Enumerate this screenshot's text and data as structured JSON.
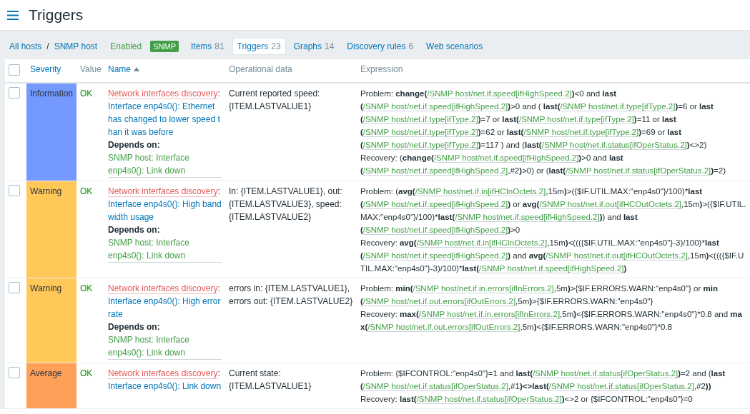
{
  "page": {
    "title": "Triggers"
  },
  "breadcrumb": [
    "All hosts",
    "SNMP host"
  ],
  "breadcrumb_separator": "/",
  "host_status": "Enabled",
  "availability_badges": [
    "SNMP"
  ],
  "tabs": [
    {
      "label": "Items",
      "count": "81",
      "selected": false
    },
    {
      "label": "Triggers",
      "count": "23",
      "selected": true
    },
    {
      "label": "Graphs",
      "count": "14",
      "selected": false
    },
    {
      "label": "Discovery rules",
      "count": "6",
      "selected": false
    },
    {
      "label": "Web scenarios",
      "selected": false
    }
  ],
  "table": {
    "select_all": {
      "checked": false
    },
    "name_separator": ":",
    "columns": [
      {
        "label": "Severity",
        "kind": "link",
        "sorted": false
      },
      {
        "label": "Value",
        "kind": "plain",
        "sorted": false
      },
      {
        "label": "Name",
        "kind": "link",
        "sorted": true
      },
      {
        "label": "Operational data",
        "kind": "plain",
        "sorted": false
      },
      {
        "label": "Expression",
        "kind": "plain",
        "sorted": false
      }
    ],
    "rows": [
      {
        "checked": false,
        "severity": "Information",
        "color": "#7499ff",
        "value": "OK",
        "name_prefix": "Network interfaces discovery",
        "name": "Interface enp4s0(): Ethernet has changed to lower speed than it was before",
        "depends_label": "Depends on:",
        "depends_on": [
          "SNMP host: Interface enp4s0(): Link down"
        ],
        "operational_data": "Current reported speed: {ITEM.LASTVALUE1}",
        "expression": [
          [
            {
              "kind": "text",
              "text": "Problem: "
            },
            {
              "kind": "func",
              "text": "change("
            },
            {
              "kind": "item",
              "text": "/SNMP host/net.if.speed[ifHighSpeed.2]"
            },
            {
              "kind": "func",
              "text": ")"
            },
            {
              "kind": "text",
              "text": "<0 and "
            },
            {
              "kind": "func",
              "text": "last("
            },
            {
              "kind": "item",
              "text": "/SNMP host/net.if.speed[ifHighSpeed.2]"
            },
            {
              "kind": "func",
              "text": ")"
            },
            {
              "kind": "text",
              "text": ">0 and ( "
            },
            {
              "kind": "func",
              "text": "last("
            },
            {
              "kind": "item",
              "text": "/SNMP host/net.if.type[ifType.2]"
            },
            {
              "kind": "func",
              "text": ")"
            },
            {
              "kind": "text",
              "text": "=6 or "
            },
            {
              "kind": "func",
              "text": "last("
            },
            {
              "kind": "item",
              "text": "/SNMP host/net.if.type[ifType.2]"
            },
            {
              "kind": "func",
              "text": ")"
            },
            {
              "kind": "text",
              "text": "=7 or "
            },
            {
              "kind": "func",
              "text": "last("
            },
            {
              "kind": "item",
              "text": "/SNMP host/net.if.type[ifType.2]"
            },
            {
              "kind": "func",
              "text": ")"
            },
            {
              "kind": "text",
              "text": "=11 or "
            },
            {
              "kind": "func",
              "text": "last("
            },
            {
              "kind": "item",
              "text": "/SNMP host/net.if.type[ifType.2]"
            },
            {
              "kind": "func",
              "text": ")"
            },
            {
              "kind": "text",
              "text": "=62 or "
            },
            {
              "kind": "func",
              "text": "last("
            },
            {
              "kind": "item",
              "text": "/SNMP host/net.if.type[ifType.2]"
            },
            {
              "kind": "func",
              "text": ")"
            },
            {
              "kind": "text",
              "text": "=69 or "
            },
            {
              "kind": "func",
              "text": "last("
            },
            {
              "kind": "item",
              "text": "/SNMP host/net.if.type[ifType.2]"
            },
            {
              "kind": "func",
              "text": ")"
            },
            {
              "kind": "text",
              "text": "=117 ) and ("
            },
            {
              "kind": "func",
              "text": "last("
            },
            {
              "kind": "item",
              "text": "/SNMP host/net.if.status[ifOperStatus.2]"
            },
            {
              "kind": "func",
              "text": ")"
            },
            {
              "kind": "text",
              "text": "<>2)"
            }
          ],
          [
            {
              "kind": "text",
              "text": "Recovery: ("
            },
            {
              "kind": "func",
              "text": "change("
            },
            {
              "kind": "item",
              "text": "/SNMP host/net.if.speed[ifHighSpeed.2]"
            },
            {
              "kind": "func",
              "text": ")"
            },
            {
              "kind": "text",
              "text": ">0 and "
            },
            {
              "kind": "func",
              "text": "last("
            },
            {
              "kind": "item",
              "text": "/SNMP host/net.if.speed[ifHighSpeed.2]"
            },
            {
              "kind": "text",
              "text": ",#2"
            },
            {
              "kind": "func",
              "text": ")"
            },
            {
              "kind": "text",
              "text": ">0) or ("
            },
            {
              "kind": "func",
              "text": "last("
            },
            {
              "kind": "item",
              "text": "/SNMP host/net.if.status[ifOperStatus.2]"
            },
            {
              "kind": "func",
              "text": ")"
            },
            {
              "kind": "text",
              "text": "=2)"
            }
          ]
        ]
      },
      {
        "checked": false,
        "severity": "Warning",
        "color": "#ffc859",
        "value": "OK",
        "name_prefix": "Network interfaces discovery",
        "name": "Interface enp4s0(): High bandwidth usage",
        "depends_label": "Depends on:",
        "depends_on": [
          "SNMP host: Interface enp4s0(): Link down"
        ],
        "operational_data": "In: {ITEM.LASTVALUE1}, out: {ITEM.LASTVALUE3}, speed: {ITEM.LASTVALUE2}",
        "expression": [
          [
            {
              "kind": "text",
              "text": "Problem: ("
            },
            {
              "kind": "func",
              "text": "avg("
            },
            {
              "kind": "item",
              "text": "/SNMP host/net.if.in[ifHCInOctets.2]"
            },
            {
              "kind": "text",
              "text": ",15m"
            },
            {
              "kind": "func",
              "text": ")"
            },
            {
              "kind": "text",
              "text": ">({$IF.UTIL.MAX:\"enp4s0\"}/100)*"
            },
            {
              "kind": "func",
              "text": "last("
            },
            {
              "kind": "item",
              "text": "/SNMP host/net.if.speed[ifHighSpeed.2]"
            },
            {
              "kind": "func",
              "text": ")"
            },
            {
              "kind": "text",
              "text": " or "
            },
            {
              "kind": "func",
              "text": "avg("
            },
            {
              "kind": "item",
              "text": "/SNMP host/net.if.out[ifHCOutOctets.2]"
            },
            {
              "kind": "text",
              "text": ",15m"
            },
            {
              "kind": "func",
              "text": ")"
            },
            {
              "kind": "text",
              "text": ">({$IF.UTIL.MAX:\"enp4s0\"}/100)*"
            },
            {
              "kind": "func",
              "text": "last("
            },
            {
              "kind": "item",
              "text": "/SNMP host/net.if.speed[ifHighSpeed.2]"
            },
            {
              "kind": "func",
              "text": ")"
            },
            {
              "kind": "text",
              "text": ") and "
            },
            {
              "kind": "func",
              "text": "last("
            },
            {
              "kind": "item",
              "text": "/SNMP host/net.if.speed[ifHighSpeed.2]"
            },
            {
              "kind": "func",
              "text": ")"
            },
            {
              "kind": "text",
              "text": ">0"
            }
          ],
          [
            {
              "kind": "text",
              "text": "Recovery: "
            },
            {
              "kind": "func",
              "text": "avg("
            },
            {
              "kind": "item",
              "text": "/SNMP host/net.if.in[ifHCInOctets.2]"
            },
            {
              "kind": "text",
              "text": ",15m"
            },
            {
              "kind": "func",
              "text": ")"
            },
            {
              "kind": "text",
              "text": "<((({$IF.UTIL.MAX:\"enp4s0\"}-3)/100)*"
            },
            {
              "kind": "func",
              "text": "last("
            },
            {
              "kind": "item",
              "text": "/SNMP host/net.if.speed[ifHighSpeed.2]"
            },
            {
              "kind": "func",
              "text": ")"
            },
            {
              "kind": "text",
              "text": " and "
            },
            {
              "kind": "func",
              "text": "avg("
            },
            {
              "kind": "item",
              "text": "/SNMP host/net.if.out[ifHCOutOctets.2]"
            },
            {
              "kind": "text",
              "text": ",15m"
            },
            {
              "kind": "func",
              "text": ")"
            },
            {
              "kind": "text",
              "text": "<((({$IF.UTIL.MAX:\"enp4s0\"}-3)/100)*"
            },
            {
              "kind": "func",
              "text": "last("
            },
            {
              "kind": "item",
              "text": "/SNMP host/net.if.speed[ifHighSpeed.2]"
            },
            {
              "kind": "func",
              "text": ")"
            }
          ]
        ]
      },
      {
        "checked": false,
        "severity": "Warning",
        "color": "#ffc859",
        "value": "OK",
        "name_prefix": "Network interfaces discovery",
        "name": "Interface enp4s0(): High error rate",
        "depends_label": "Depends on:",
        "depends_on": [
          "SNMP host: Interface enp4s0(): Link down"
        ],
        "operational_data": "errors in: {ITEM.LASTVALUE1}, errors out: {ITEM.LASTVALUE2}",
        "expression": [
          [
            {
              "kind": "text",
              "text": "Problem: "
            },
            {
              "kind": "func",
              "text": "min("
            },
            {
              "kind": "item",
              "text": "/SNMP host/net.if.in.errors[ifInErrors.2]"
            },
            {
              "kind": "text",
              "text": ",5m"
            },
            {
              "kind": "func",
              "text": ")"
            },
            {
              "kind": "text",
              "text": ">{$IF.ERRORS.WARN:\"enp4s0\"} or "
            },
            {
              "kind": "func",
              "text": "min("
            },
            {
              "kind": "item",
              "text": "/SNMP host/net.if.out.errors[ifOutErrors.2]"
            },
            {
              "kind": "text",
              "text": ",5m"
            },
            {
              "kind": "func",
              "text": ")"
            },
            {
              "kind": "text",
              "text": ">{$IF.ERRORS.WARN:\"enp4s0\"}"
            }
          ],
          [
            {
              "kind": "text",
              "text": "Recovery: "
            },
            {
              "kind": "func",
              "text": "max("
            },
            {
              "kind": "item",
              "text": "/SNMP host/net.if.in.errors[ifInErrors.2]"
            },
            {
              "kind": "text",
              "text": ",5m"
            },
            {
              "kind": "func",
              "text": ")"
            },
            {
              "kind": "text",
              "text": "<{$IF.ERRORS.WARN:\"enp4s0\"}*0.8 and "
            },
            {
              "kind": "func",
              "text": "max("
            },
            {
              "kind": "item",
              "text": "/SNMP host/net.if.out.errors[ifOutErrors.2]"
            },
            {
              "kind": "text",
              "text": ",5m"
            },
            {
              "kind": "func",
              "text": ")"
            },
            {
              "kind": "text",
              "text": "<{$IF.ERRORS.WARN:\"enp4s0\"}*0.8"
            }
          ]
        ]
      },
      {
        "checked": false,
        "severity": "Average",
        "color": "#ffa059",
        "value": "OK",
        "name_prefix": "Network interfaces discovery",
        "name": "Interface enp4s0(): Link down",
        "operational_data": "Current state: {ITEM.LASTVALUE1}",
        "expression": [
          [
            {
              "kind": "text",
              "text": "Problem: {$IFCONTROL:\"enp4s0\"}=1 and "
            },
            {
              "kind": "func",
              "text": "last("
            },
            {
              "kind": "item",
              "text": "/SNMP host/net.if.status[ifOperStatus.2]"
            },
            {
              "kind": "func",
              "text": ")"
            },
            {
              "kind": "text",
              "text": "=2 and ("
            },
            {
              "kind": "func",
              "text": "last("
            },
            {
              "kind": "item",
              "text": "/SNMP host/net.if.status[ifOperStatus.2]"
            },
            {
              "kind": "text",
              "text": ",#1"
            },
            {
              "kind": "func",
              "text": ")<>last("
            },
            {
              "kind": "item",
              "text": "/SNMP host/net.if.status[ifOperStatus.2]"
            },
            {
              "kind": "text",
              "text": ",#2"
            },
            {
              "kind": "func",
              "text": "))"
            }
          ],
          [
            {
              "kind": "text",
              "text": "Recovery: "
            },
            {
              "kind": "func",
              "text": "last("
            },
            {
              "kind": "item",
              "text": "/SNMP host/net.if.status[ifOperStatus.2]"
            },
            {
              "kind": "func",
              "text": ")"
            },
            {
              "kind": "text",
              "text": "<>2 or {$IFCONTROL:\"enp4s0\"}=0"
            }
          ]
        ]
      }
    ]
  }
}
